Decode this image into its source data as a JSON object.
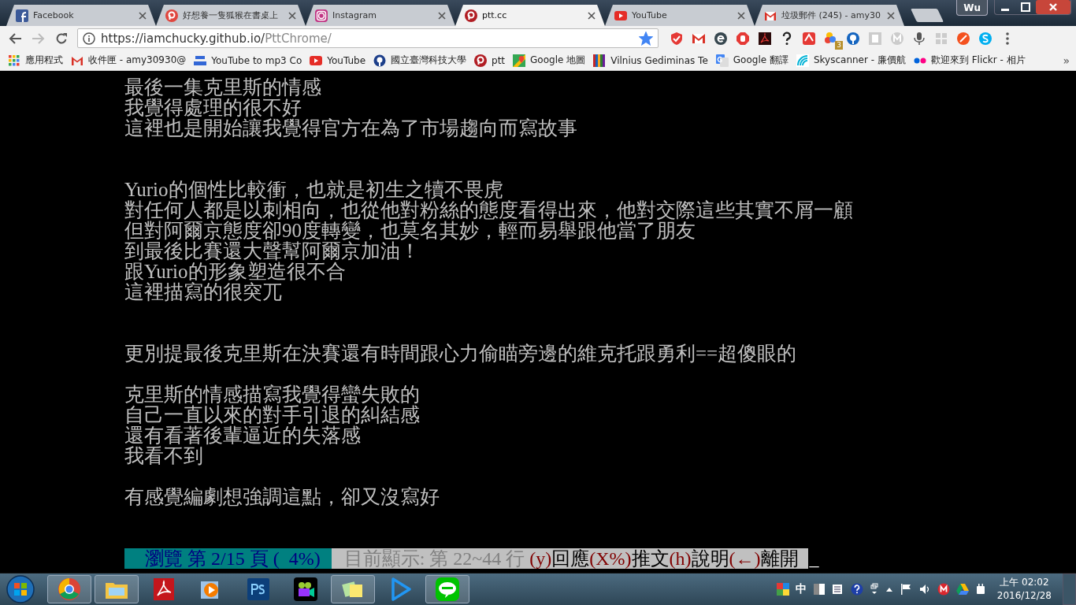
{
  "window": {
    "profile": "Wu"
  },
  "tabs": [
    {
      "title": "Facebook",
      "selected": false
    },
    {
      "title": "好想養一隻狐猴在書桌上",
      "selected": false
    },
    {
      "title": "Instagram",
      "selected": false
    },
    {
      "title": "ptt.cc",
      "selected": true
    },
    {
      "title": "YouTube",
      "selected": false
    },
    {
      "title": "垃圾郵件 (245) - amy30",
      "selected": false
    }
  ],
  "address_bar": {
    "host": "https://iamchucky.github.io/",
    "path": "PttChrome/",
    "bookmarked": true
  },
  "extension_badge": "3",
  "bookmarks": [
    {
      "label": "應用程式"
    },
    {
      "label": "收件匣 - amy30930@"
    },
    {
      "label": "YouTube to mp3 Co"
    },
    {
      "label": "YouTube"
    },
    {
      "label": "國立臺灣科技大學"
    },
    {
      "label": "ptt"
    },
    {
      "label": "Google 地圖"
    },
    {
      "label": "Vilnius Gediminas Te"
    },
    {
      "label": "Google 翻譯"
    },
    {
      "label": "Skyscanner - 廉價航"
    },
    {
      "label": "歡迎來到 Flickr - 相片"
    }
  ],
  "bookmarks_more": "»",
  "article": [
    {
      "kind": "text",
      "text": "最後一集克里斯的情感"
    },
    {
      "kind": "text",
      "text": "我覺得處理的很不好"
    },
    {
      "kind": "text",
      "text": "這裡也是開始讓我覺得官方在為了市場趨向而寫故事"
    },
    {
      "kind": "blank"
    },
    {
      "kind": "blank"
    },
    {
      "kind": "text",
      "text": "Yurio的個性比較衝，也就是初生之犢不畏虎"
    },
    {
      "kind": "text",
      "text": "對任何人都是以刺相向，也從他對粉絲的態度看得出來，他對交際這些其實不屑一顧"
    },
    {
      "kind": "text",
      "text": "但對阿爾京態度卻90度轉變，也莫名其妙，輕而易舉跟他當了朋友"
    },
    {
      "kind": "text",
      "text": "到最後比賽還大聲幫阿爾京加油！"
    },
    {
      "kind": "text",
      "text": "跟Yurio的形象塑造很不合"
    },
    {
      "kind": "text",
      "text": "這裡描寫的很突兀"
    },
    {
      "kind": "blank"
    },
    {
      "kind": "blank"
    },
    {
      "kind": "text",
      "text": "更別提最後克里斯在決賽還有時間跟心力偷瞄旁邊的維克托跟勇利==超傻眼的"
    },
    {
      "kind": "blank"
    },
    {
      "kind": "text",
      "text": "克里斯的情感描寫我覺得蠻失敗的"
    },
    {
      "kind": "text",
      "text": "自己一直以來的對手引退的糾結感"
    },
    {
      "kind": "text",
      "text": "還有看著後輩逼近的失落感"
    },
    {
      "kind": "text",
      "text": "我看不到"
    },
    {
      "kind": "blank"
    },
    {
      "kind": "text",
      "text": "有感覺編劇想強調這點，卻又沒寫好"
    },
    {
      "kind": "blank"
    },
    {
      "kind": "blank"
    }
  ],
  "status_line": {
    "page_info": "瀏覽 第 2/15 頁 (  4%)",
    "segments": [
      {
        "kind": "info",
        "text": "目前顯示: 第 22~44 行 "
      },
      {
        "kind": "key",
        "text": "(y)"
      },
      {
        "kind": "action",
        "text": "回應"
      },
      {
        "kind": "key",
        "text": "(X%)"
      },
      {
        "kind": "action",
        "text": "推文"
      },
      {
        "kind": "key",
        "text": "(h)"
      },
      {
        "kind": "action",
        "text": "說明"
      },
      {
        "kind": "key",
        "text": "(←)"
      },
      {
        "kind": "action",
        "text": "離開"
      }
    ],
    "cursor": "_"
  },
  "taskbar": {
    "apps": [
      {
        "running": true
      },
      {
        "running": true
      },
      {
        "running": false
      },
      {
        "running": false
      },
      {
        "running": false
      },
      {
        "running": false
      },
      {
        "running": true
      },
      {
        "running": false
      },
      {
        "running": true
      }
    ],
    "ime": "中",
    "time": "上午 02:02",
    "date": "2016/12/28"
  }
}
